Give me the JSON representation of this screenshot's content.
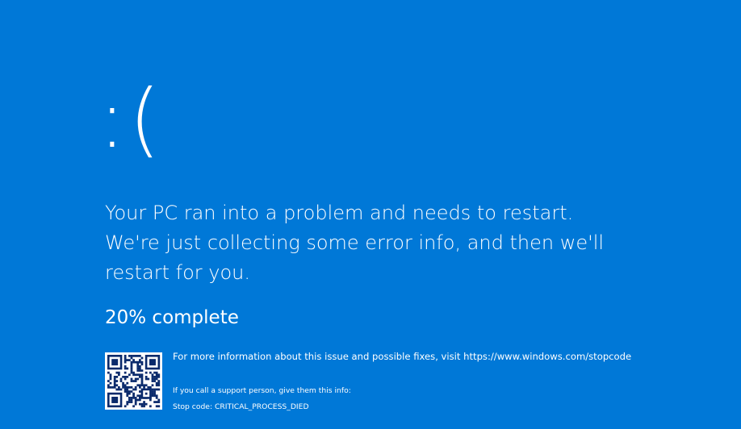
{
  "screen": {
    "background_color": "#0078d7",
    "text_color": "#ffffff"
  },
  "sad_face": ":(",
  "message": "Your PC ran into a problem and needs to restart. We're just collecting some error info, and then we'll restart for you.",
  "progress": {
    "text": "20% complete",
    "percent": 20
  },
  "qr_code": {
    "icon": "qr-code-icon"
  },
  "more_info": "For more information about this issue and possible fixes, visit https://www.windows.com/stopcode",
  "support_note": "If you call a support person, give them this info:",
  "stop_code": "Stop code: CRITICAL_PROCESS_DIED"
}
